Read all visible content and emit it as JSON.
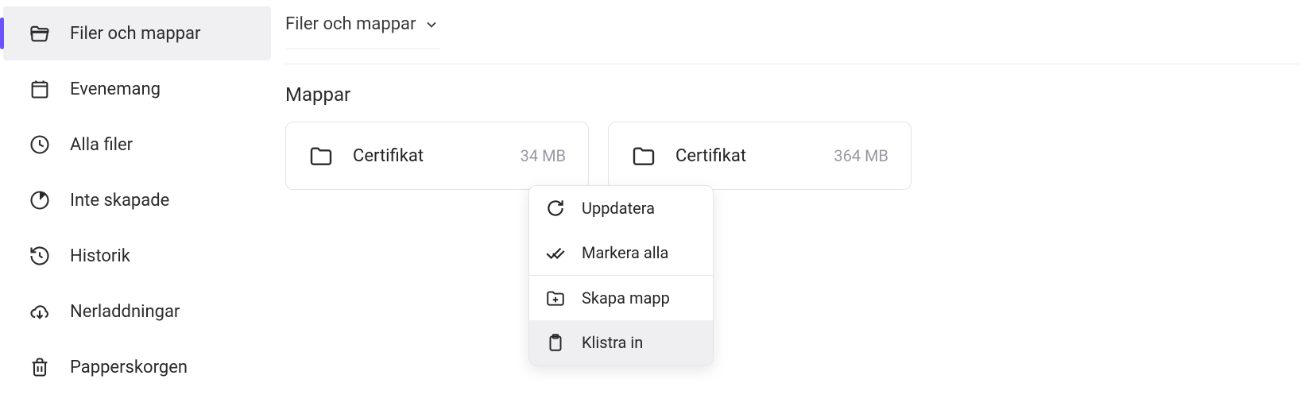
{
  "sidebar": {
    "items": [
      {
        "label": "Filer och mappar"
      },
      {
        "label": "Evenemang"
      },
      {
        "label": "Alla filer"
      },
      {
        "label": "Inte skapade"
      },
      {
        "label": "Historik"
      },
      {
        "label": "Nerladdningar"
      },
      {
        "label": "Papperskorgen"
      }
    ]
  },
  "breadcrumb": {
    "label": "Filer och mappar"
  },
  "section_title": "Mappar",
  "folders": [
    {
      "name": "Certifikat",
      "size": "34 MB"
    },
    {
      "name": "Certifikat",
      "size": "364 MB"
    }
  ],
  "context_menu": {
    "items": [
      {
        "label": "Uppdatera"
      },
      {
        "label": "Markera alla"
      },
      {
        "label": "Skapa mapp"
      },
      {
        "label": "Klistra in"
      }
    ]
  }
}
